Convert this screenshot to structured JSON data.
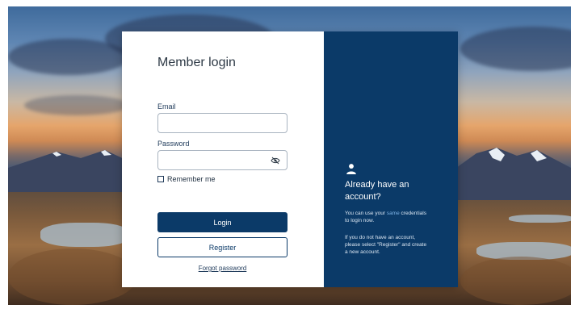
{
  "login_panel": {
    "title": "Member login",
    "email_label": "Email",
    "email_value": "",
    "password_label": "Password",
    "password_value": "",
    "remember_label": "Remember me",
    "login_button": "Login",
    "register_button": "Register",
    "forgot_link": "Forgot password"
  },
  "info_panel": {
    "heading_line1": "Already have an",
    "heading_line2": "account?",
    "text1_part1": "You can use your",
    "text1_highlight": "same",
    "text1_part2": "credentials",
    "text1_line2": "to login now.",
    "text2_line1": "If you do not have an account,",
    "text2_line2": "please select \"Register\" and create",
    "text2_line3": "a new account."
  },
  "colors": {
    "brand": "#0b3a68",
    "panel_text": "#dbe6f2",
    "highlight": "#7db3e6"
  },
  "icons": {
    "password_toggle": "eye-slash-icon",
    "info": "user-icon"
  }
}
